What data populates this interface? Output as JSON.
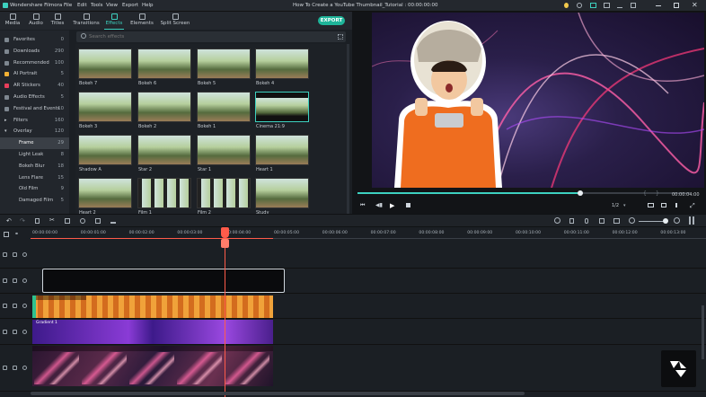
{
  "window": {
    "app_name": "Wondershare Filmora",
    "menu": [
      "File",
      "Edit",
      "Tools",
      "View",
      "Export",
      "Help"
    ],
    "title": "How To Create a YouTube Thumbnail_Tutorial : 00:00:00:00"
  },
  "tabs": [
    "Media",
    "Audio",
    "Titles",
    "Transitions",
    "Effects",
    "Elements",
    "Split Screen"
  ],
  "active_tab": "Effects",
  "export_label": "EXPORT",
  "search": {
    "placeholder": "Search effects"
  },
  "sidebar": [
    {
      "label": "Favorites",
      "count": "0"
    },
    {
      "label": "Downloads",
      "count": "290"
    },
    {
      "label": "Recommended",
      "count": "100"
    },
    {
      "label": "AI Portrait",
      "count": "5"
    },
    {
      "label": "AR Stickers",
      "count": "40"
    },
    {
      "label": "Audio Effects",
      "count": "5"
    },
    {
      "label": "Festival and Events",
      "count": "10"
    },
    {
      "label": "Filters",
      "count": "160"
    },
    {
      "label": "Overlay",
      "count": "120"
    },
    {
      "label": "Frame",
      "count": "29"
    },
    {
      "label": "Light Leak",
      "count": "8"
    },
    {
      "label": "Bokeh Blur",
      "count": "18"
    },
    {
      "label": "Lens Flare",
      "count": "15"
    },
    {
      "label": "Old Film",
      "count": "9"
    },
    {
      "label": "Damaged Film",
      "count": "5"
    }
  ],
  "effects": [
    [
      "Bokeh 7",
      "Bokeh 6",
      "Bokeh 5",
      "Bokeh 4"
    ],
    [
      "Bokeh 3",
      "Bokeh 2",
      "Bokeh 1",
      "Cinema 21:9"
    ],
    [
      "Shadow A",
      "Star 2",
      "Star 1",
      "Heart 1"
    ],
    [
      "Heart 2",
      "Film 1",
      "Film 2",
      "Study"
    ]
  ],
  "selected_effect": "Cinema 21:9",
  "preview": {
    "timecode": "00:00:04:00",
    "quality": "1/2",
    "progress": 0.67
  },
  "ruler": [
    "00:00:00:00",
    "00:00:01:00",
    "00:00:02:00",
    "00:00:03:00",
    "00:00:04:00",
    "00:00:05:00",
    "00:00:06:00",
    "00:00:07:00",
    "00:00:08:00",
    "00:00:09:00",
    "00:00:10:00",
    "00:00:11:00",
    "00:00:12:00",
    "00:00:13:00"
  ],
  "clips": {
    "gold": "",
    "purple": "Gradient 1",
    "neon": ""
  },
  "colors": {
    "accent": "#3dd1c0",
    "playhead": "#ff5b4a",
    "export": "#1fb59a"
  }
}
